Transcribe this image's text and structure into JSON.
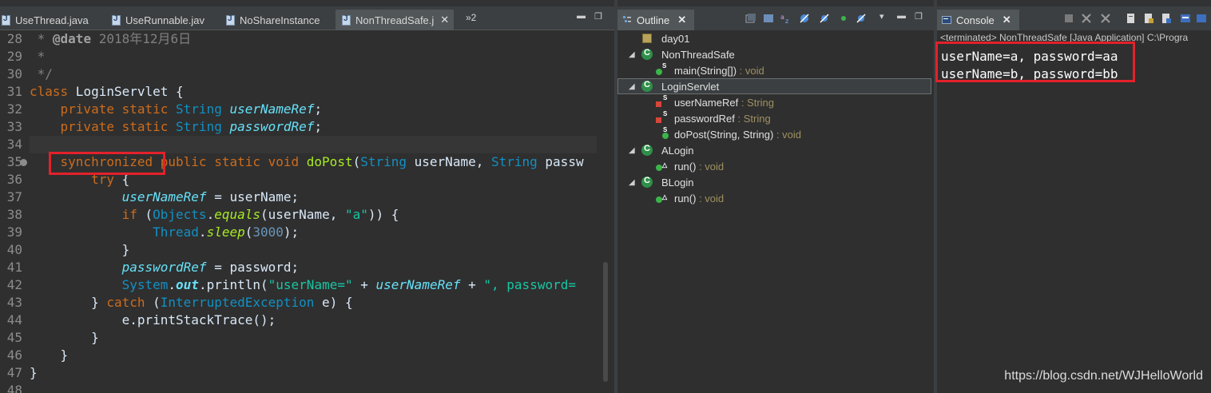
{
  "editor": {
    "tabs": [
      {
        "label": "UseThread.java"
      },
      {
        "label": "UseRunnable.jav"
      },
      {
        "label": "NoShareInstance"
      },
      {
        "label": "NonThreadSafe.j",
        "active": true
      }
    ],
    "overflow_label": "»2",
    "line_numbers": [
      "28",
      "29",
      "30",
      "31",
      "32",
      "33",
      "34",
      "35",
      "36",
      "37",
      "38",
      "39",
      "40",
      "41",
      "42",
      "43",
      "44",
      "45",
      "46",
      "47",
      "48"
    ],
    "lines": {
      "l28": {
        "a": " * ",
        "b": "@date",
        "c": " 2018年12月6日"
      },
      "l29": " *",
      "l30": " */",
      "l31": {
        "kw": "class",
        "name": " LoginServlet {"
      },
      "l32": {
        "mods": "    private static ",
        "type": "String",
        "sp": " ",
        "field": "userNameRef",
        "end": ";"
      },
      "l33": {
        "mods": "    private static ",
        "type": "String",
        "sp": " ",
        "field": "passwordRef",
        "end": ";"
      },
      "l35": {
        "indent": "    ",
        "sync": "synchronized",
        "mods": " public static void ",
        "fn": "doPost",
        "p1": "(",
        "t1": "String",
        "a1": " userName, ",
        "t2": "String",
        "a2": " passw"
      },
      "l36": {
        "indent": "        ",
        "kw": "try",
        "rest": " {"
      },
      "l37": {
        "indent": "            ",
        "field": "userNameRef",
        "rest": " = userName;"
      },
      "l38": {
        "indent": "            ",
        "kw": "if",
        "p": " (",
        "type": "Objects",
        "dot": ".",
        "fn": "equals",
        "args": "(userName, ",
        "str": "\"a\"",
        "end": ")) {"
      },
      "l39": {
        "indent": "                ",
        "type": "Thread",
        "dot": ".",
        "fn": "sleep",
        "p": "(",
        "num": "3000",
        "end": ");"
      },
      "l40": "            }",
      "l41": {
        "indent": "            ",
        "field": "passwordRef",
        "rest": " = password;"
      },
      "l42": {
        "indent": "            ",
        "type": "System",
        "dot": ".",
        "out": "out",
        "fn": ".println(",
        "str": "\"userName=\"",
        "plus": " + ",
        "field": "userNameRef",
        "plus2": " + ",
        "str2": "\", password="
      },
      "l43": {
        "indent": "        ",
        "close": "} ",
        "kw": "catch",
        "p": " (",
        "type": "InterruptedException",
        "rest": " e) {"
      },
      "l44": "            e.printStackTrace();",
      "l45": "        }",
      "l46": "    }",
      "l47": "}"
    }
  },
  "outline": {
    "title": "Outline",
    "items": [
      {
        "label": "day01",
        "type": ""
      },
      {
        "label": "NonThreadSafe",
        "type": ""
      },
      {
        "label": "main(String[])",
        "type": " : void"
      },
      {
        "label": "LoginServlet",
        "type": ""
      },
      {
        "label": "userNameRef",
        "type": " : String"
      },
      {
        "label": "passwordRef",
        "type": " : String"
      },
      {
        "label": "doPost(String, String)",
        "type": " : void"
      },
      {
        "label": "ALogin",
        "type": ""
      },
      {
        "label": "run()",
        "type": " : void"
      },
      {
        "label": "BLogin",
        "type": ""
      },
      {
        "label": "run()",
        "type": " : void"
      }
    ]
  },
  "console": {
    "title": "Console",
    "header": "<terminated> NonThreadSafe [Java Application] C:\\Progra",
    "output": [
      "userName=a, password=aa",
      "userName=b, password=bb"
    ]
  },
  "watermark": "https://blog.csdn.net/WJHelloWorld",
  "colors": {
    "background": "#2f2f2f",
    "keyword": "#cc6c1d",
    "type": "#1290c3",
    "field": "#66e1f8",
    "method": "#a7ec21",
    "string": "#17c6a3",
    "highlight_box": "#e3212a"
  }
}
